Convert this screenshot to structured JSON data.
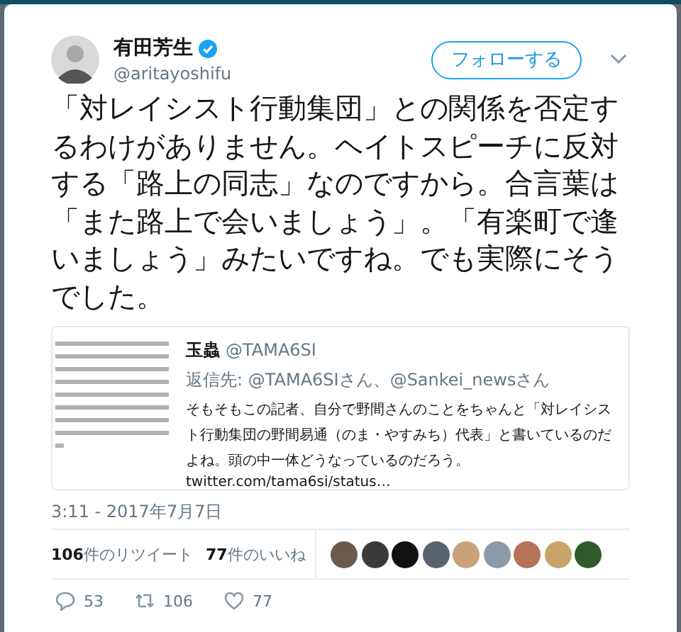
{
  "author": {
    "name": "有田芳生",
    "verified": true,
    "handle": "@aritayoshifu"
  },
  "follow_button": "フォローする",
  "text": "「対レイシスト行動集団」との関係を否定するわけがありません。ヘイトスピーチに反対する「路上の同志」なのですから。合言葉は「また路上で会いましょう」。「有楽町で逢いましょう」みたいですね。でも実際にそうでした。",
  "quoted_tweet": {
    "name": "玉蟲",
    "handle": "@TAMA6SI",
    "reply_to": "返信先: @TAMA6SIさん、@Sankei_newsさん",
    "text": "そもそもこの記者、自分で野間さんのことをちゃんと「対レイシスト行動集団の野間易通（のま・やすみち）代表」と書いているのだよね。頭の中一体どうなっているのだろう。",
    "link": "twitter.com/tama6si/status…"
  },
  "timestamp": "3:11 - 2017年7月7日",
  "stats": [
    "**106**件のリツイート",
    "**77**件のいいね"
  ],
  "likers": [
    {
      "color": "#6b5a4a"
    },
    {
      "color": "#3a3a3a"
    },
    {
      "color": "#111111"
    },
    {
      "color": "#5a6470"
    },
    {
      "color": "#c9a27a"
    },
    {
      "color": "#8a9aa8"
    },
    {
      "color": "#b5735a"
    },
    {
      "color": "#c8a46a"
    },
    {
      "color": "#2f5a2a"
    }
  ],
  "actions": [
    {
      "kind": "reply",
      "count": "53"
    },
    {
      "kind": "retweet",
      "count": "106"
    },
    {
      "kind": "like",
      "count": "77"
    }
  ]
}
